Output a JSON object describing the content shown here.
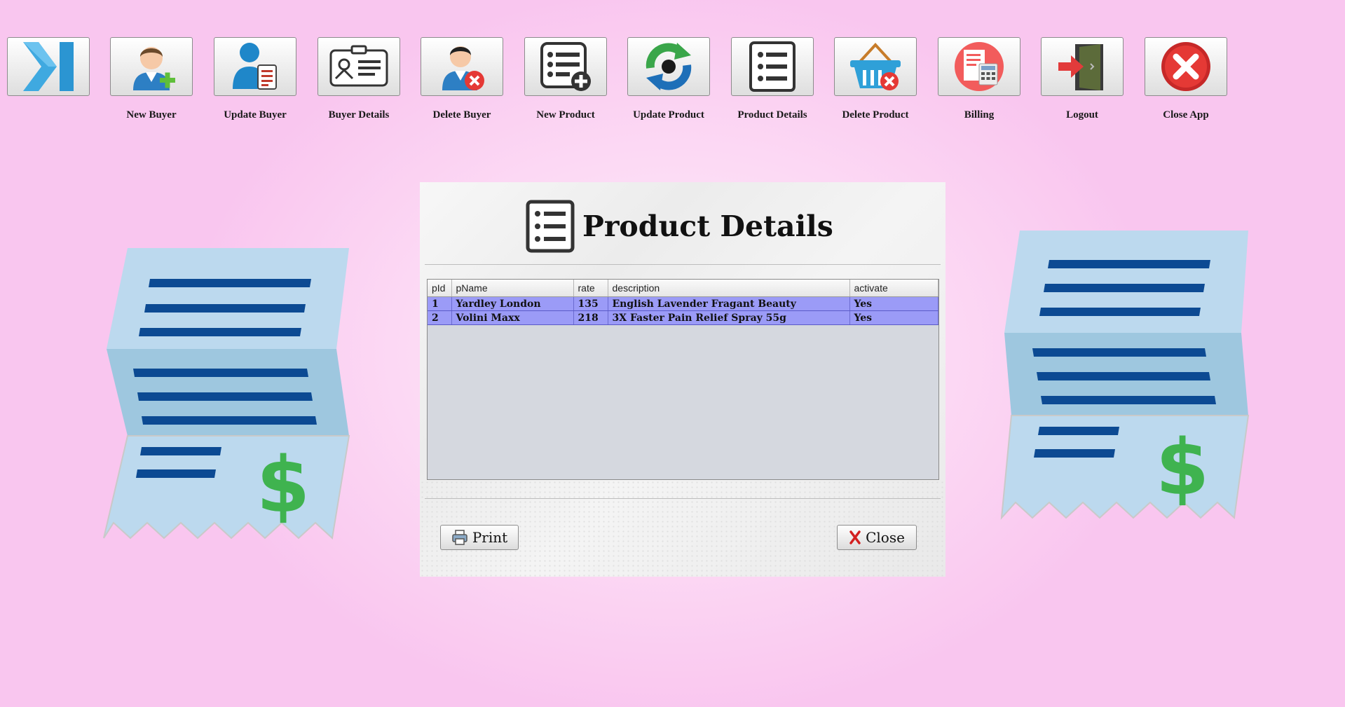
{
  "toolbar": {
    "items": [
      {
        "label": "",
        "icon": "next-arrow-icon"
      },
      {
        "label": "New Buyer",
        "icon": "add-user-icon"
      },
      {
        "label": "Update Buyer",
        "icon": "update-user-icon"
      },
      {
        "label": "Buyer Details",
        "icon": "id-card-icon"
      },
      {
        "label": "Delete Buyer",
        "icon": "delete-user-icon"
      },
      {
        "label": "New Product",
        "icon": "add-list-icon"
      },
      {
        "label": "Update Product",
        "icon": "refresh-icon"
      },
      {
        "label": "Product Details",
        "icon": "list-icon"
      },
      {
        "label": "Delete Product",
        "icon": "delete-basket-icon"
      },
      {
        "label": "Billing",
        "icon": "bill-calculator-icon"
      },
      {
        "label": "Logout",
        "icon": "exit-door-icon"
      },
      {
        "label": "Close App",
        "icon": "close-circle-icon"
      }
    ]
  },
  "dialog": {
    "title": "Product Details",
    "columns": [
      "pId",
      "pName",
      "rate",
      "description",
      "activate"
    ],
    "rows": [
      [
        "1",
        "Yardley London",
        "135",
        "English Lavender Fragant Beauty",
        "Yes"
      ],
      [
        "2",
        "Volini Maxx",
        "218",
        "3X Faster Pain Relief Spray 55g",
        "Yes"
      ]
    ],
    "print_label": "Print",
    "close_label": "Close"
  },
  "colors": {
    "background": "#fad0f1",
    "row_selected": "#9b9bf7",
    "receipt_paper": "#bcd9ee",
    "receipt_line": "#0c4a93",
    "dollar": "#3fb34f"
  }
}
